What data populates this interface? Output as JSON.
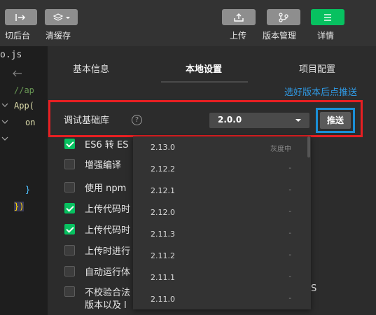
{
  "toolbar": {
    "buttons": [
      {
        "icon": "switch-background-icon",
        "label": "切后台"
      },
      {
        "icon": "layers-icon",
        "label": "清缓存"
      },
      {
        "icon": "upload-icon",
        "label": "上传"
      },
      {
        "icon": "branch-icon",
        "label": "版本管理"
      },
      {
        "icon": "menu-icon",
        "label": "详情"
      }
    ]
  },
  "code": {
    "file": "o.js",
    "lines": [
      "//ap",
      "App(",
      "on",
      "}",
      "})"
    ]
  },
  "panel": {
    "tabs": [
      "基本信息",
      "本地设置",
      "项目配置"
    ],
    "active_tab": "本地设置",
    "link_text": "选好版本后点推送",
    "base_lib": {
      "label": "调试基础库",
      "help": "?",
      "selected": "2.0.0",
      "push_label": "推送"
    },
    "options": [
      {
        "label": "ES6 转 ES",
        "checked": true
      },
      {
        "label": "增强编译",
        "checked": false
      },
      {
        "label": "使用 npm",
        "checked": false
      },
      {
        "label": "上传代码时",
        "checked": true
      },
      {
        "label": "上传代码时",
        "checked": true
      },
      {
        "label": "上传时进行",
        "checked": false
      },
      {
        "label": "自动运行体",
        "checked": false
      },
      {
        "label": "不校验合法",
        "checked": false
      }
    ],
    "option_extra_line": "版本以及 l",
    "right_fragment": "S"
  },
  "dropdown": {
    "items": [
      {
        "version": "2.13.0",
        "tag": "灰度中"
      },
      {
        "version": "2.12.2",
        "tag": "-"
      },
      {
        "version": "2.12.1",
        "tag": "-"
      },
      {
        "version": "2.12.0",
        "tag": "-"
      },
      {
        "version": "2.11.3",
        "tag": "-"
      },
      {
        "version": "2.11.2",
        "tag": "-"
      },
      {
        "version": "2.11.1",
        "tag": "-"
      },
      {
        "version": "2.11.0",
        "tag": "-"
      }
    ]
  },
  "colors": {
    "accent_green": "#07c160",
    "highlight_red": "#e81f22",
    "highlight_blue": "#1a8fd6",
    "link_blue": "#2f9be6"
  }
}
